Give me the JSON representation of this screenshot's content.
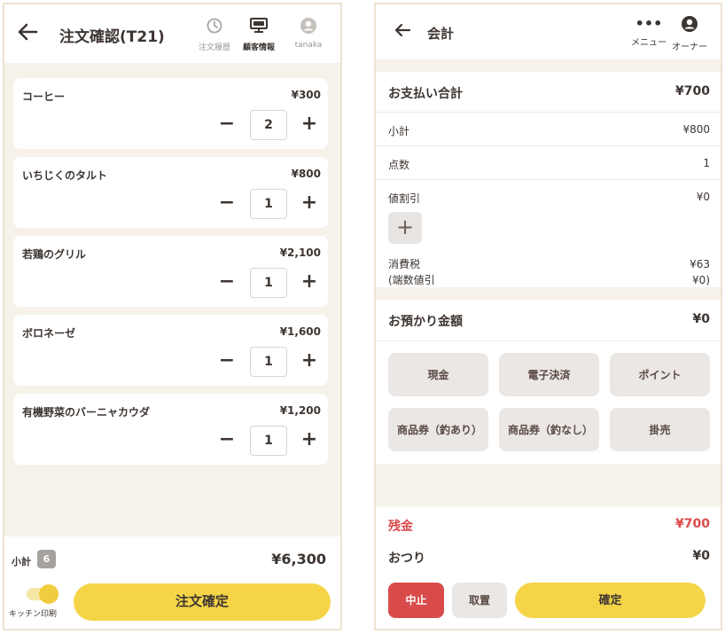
{
  "order_screen": {
    "title": "注文確認(T21)",
    "header_icons": [
      {
        "label": "注文履歴",
        "icon": "history-icon"
      },
      {
        "label": "顧客情報",
        "icon": "customer-info-icon"
      },
      {
        "label": "tanaka",
        "icon": "user-avatar-icon"
      }
    ],
    "items": [
      {
        "name": "コーヒー",
        "price": "¥300",
        "qty": "2"
      },
      {
        "name": "いちじくのタルト",
        "price": "¥800",
        "qty": "1"
      },
      {
        "name": "若鶏のグリル",
        "price": "¥2,100",
        "qty": "1"
      },
      {
        "name": "ボロネーゼ",
        "price": "¥1,600",
        "qty": "1"
      },
      {
        "name": "有機野菜のバーニャカウダ",
        "price": "¥1,200",
        "qty": "1"
      }
    ],
    "footer": {
      "subtotal_label": "小計",
      "item_count": "6",
      "subtotal_value": "¥6,300",
      "kitchen_print_label": "キッチン印刷",
      "kitchen_print_on": true,
      "confirm_label": "注文確定"
    }
  },
  "checkout_screen": {
    "title": "会計",
    "header_icons": [
      {
        "label": "メニュー",
        "icon": "more-dots-icon"
      },
      {
        "label": "オーナー",
        "icon": "owner-avatar-icon"
      }
    ],
    "summary": {
      "total_label": "お支払い合計",
      "total_value": "¥700",
      "subtotal_label": "小計",
      "subtotal_value": "¥800",
      "count_label": "点数",
      "count_value": "1",
      "discount_label": "値割引",
      "discount_value": "¥0",
      "tax_label": "消費税",
      "tax_value": "¥63",
      "rounding_label": "(端数値引",
      "rounding_value": "¥0)"
    },
    "deposit": {
      "label": "お預かり金額",
      "value": "¥0"
    },
    "payment_methods": [
      "現金",
      "電子決済",
      "ポイント",
      "商品券（釣あり）",
      "商品券（釣なし）",
      "掛売"
    ],
    "footer": {
      "remaining_label": "残金",
      "remaining_value": "¥700",
      "change_label": "おつり",
      "change_value": "¥0",
      "stop_label": "中止",
      "cancel_label": "取置",
      "finalize_label": "確定"
    }
  },
  "colors": {
    "accent_yellow": "#f5d547",
    "danger_red": "#d94b4b",
    "panel_bg": "#f6f2ea"
  }
}
